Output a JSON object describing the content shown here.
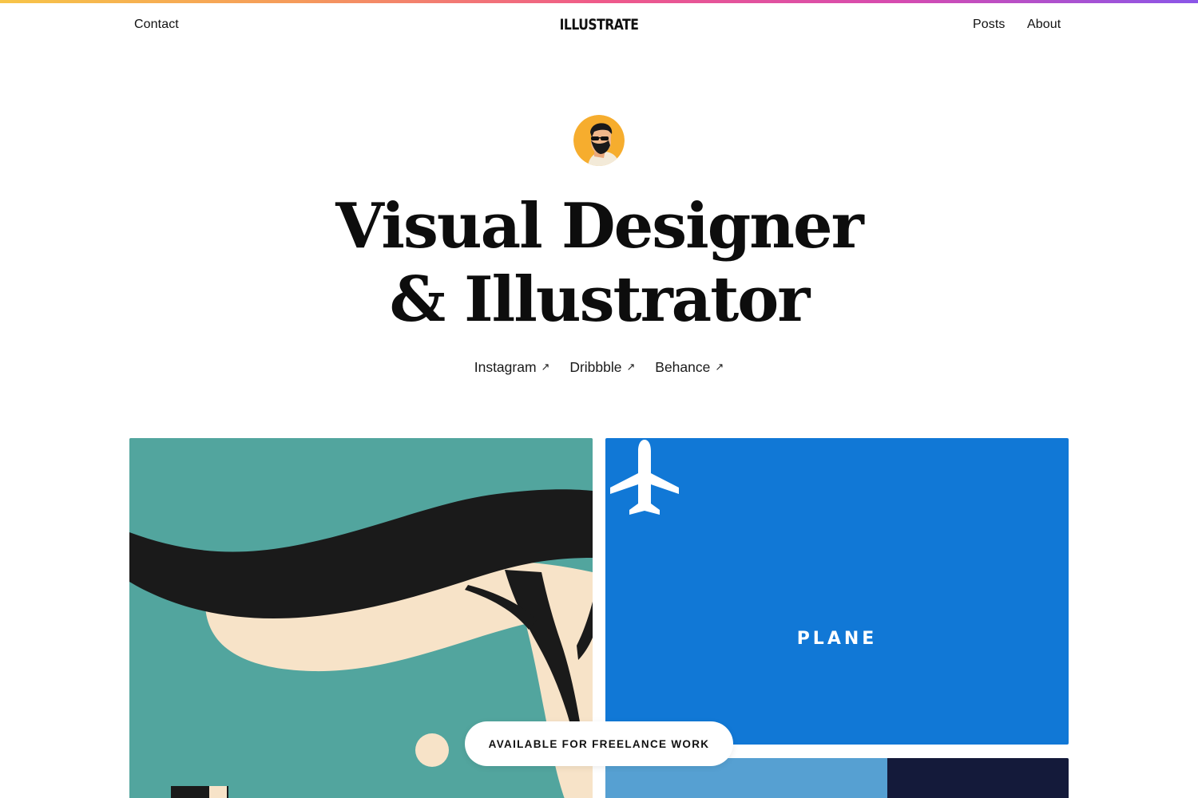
{
  "nav": {
    "contact_label": "Contact",
    "logo_text": "ILLUSTRATE",
    "posts_label": "Posts",
    "about_label": "About"
  },
  "hero": {
    "avatar_icon": "bearded-man-avatar-icon",
    "title_line1": "Visual Designer",
    "title_line2": "& Illustrator"
  },
  "socials": [
    {
      "label": "Instagram",
      "arrow": "↗"
    },
    {
      "label": "Dribbble",
      "arrow": "↗"
    },
    {
      "label": "Behance",
      "arrow": "↗"
    }
  ],
  "portfolio": {
    "card_blue_label": "PLANE",
    "card_blue_icon": "airplane-icon"
  },
  "freelance_badge": "AVAILABLE FOR FREELANCE WORK",
  "colors": {
    "teal": "#52a59e",
    "blue": "#1178d6",
    "cream": "#f7e3c8",
    "dark": "#1a1a1a",
    "avatar_bg": "#f6ad2e",
    "stripe_start": "#f7c548",
    "stripe_end": "#8a56e8"
  }
}
